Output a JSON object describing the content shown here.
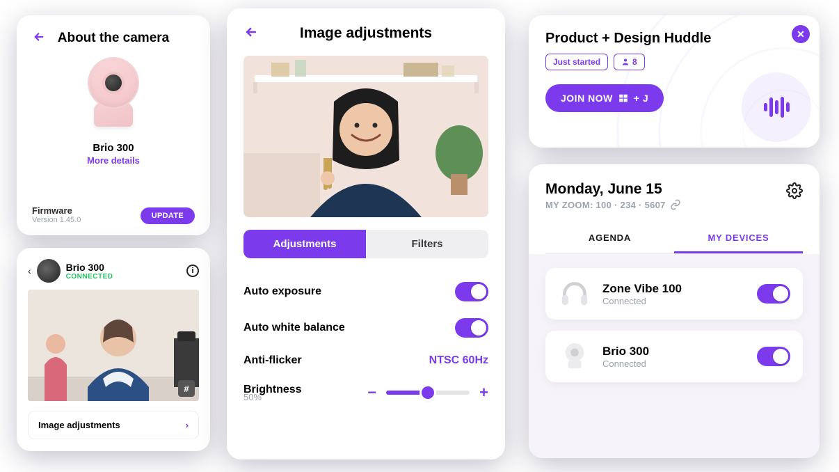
{
  "aboutCamera": {
    "title": "About the camera",
    "productName": "Brio 300",
    "moreDetails": "More details",
    "firmwareLabel": "Firmware",
    "firmwareVersion": "Version 1.45.0",
    "updateButton": "UPDATE"
  },
  "brioPreview": {
    "deviceName": "Brio 300",
    "status": "CONNECTED",
    "settingsRow": "Image adjustments",
    "hashChip": "#"
  },
  "adjustments": {
    "title": "Image adjustments",
    "tabs": {
      "adjustments": "Adjustments",
      "filters": "Filters"
    },
    "settings": {
      "autoExposure": "Auto exposure",
      "autoWhiteBalance": "Auto white balance",
      "antiFlickerLabel": "Anti-flicker",
      "antiFlickerValue": "NTSC 60Hz",
      "brightnessLabel": "Brightness",
      "brightnessValue": "50%"
    }
  },
  "huddle": {
    "title": "Product + Design Huddle",
    "justStarted": "Just started",
    "attendees": "8",
    "joinLabel": "JOIN NOW",
    "shortcut": "+ J"
  },
  "devices": {
    "date": "Monday, June 15",
    "zoomLabel": "MY ZOOM: 100 · 234 · 5607",
    "tabs": {
      "agenda": "AGENDA",
      "myDevices": "MY DEVICES"
    },
    "list": [
      {
        "name": "Zone Vibe 100",
        "status": "Connected"
      },
      {
        "name": "Brio 300",
        "status": "Connected"
      }
    ]
  }
}
